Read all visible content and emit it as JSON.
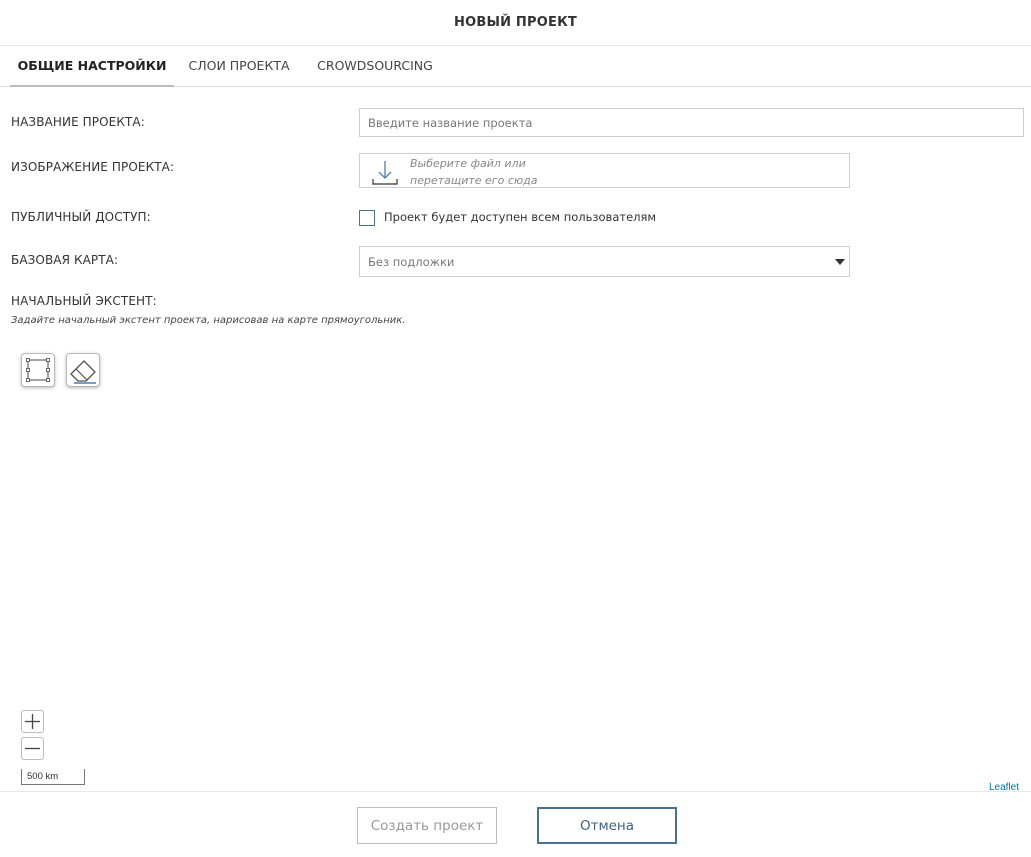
{
  "header": {
    "title": "НОВЫЙ ПРОЕКТ"
  },
  "tabs": [
    {
      "label": "ОБЩИЕ НАСТРОЙКИ",
      "active": true
    },
    {
      "label": "СЛОИ ПРОЕКТА",
      "active": false
    },
    {
      "label": "CROWDSOURCING",
      "active": false
    }
  ],
  "form": {
    "name": {
      "label": "НАЗВАНИЕ ПРОЕКТА:",
      "placeholder": "Введите название проекта",
      "value": ""
    },
    "image": {
      "label": "ИЗОБРАЖЕНИЕ ПРОЕКТА:",
      "hint_line1": "Выберите файл или",
      "hint_line2": "перетащите его сюда"
    },
    "public": {
      "label": "ПУБЛИЧНЫЙ ДОСТУП:",
      "checkbox_label": "Проект будет доступен всем пользователям",
      "checked": false
    },
    "basemap": {
      "label": "БАЗОВАЯ КАРТА:",
      "selected": "Без подложки"
    },
    "extent": {
      "label": "НАЧАЛЬНЫЙ ЭКСТЕНТ:",
      "hint": "Задайте начальный экстент проекта, нарисовав на карте прямоугольник."
    }
  },
  "map": {
    "scale": "500 km",
    "attribution": "Leaflet"
  },
  "footer": {
    "create_label": "Создать проект",
    "cancel_label": "Отмена"
  },
  "colors": {
    "accent": "#4a7193",
    "checkbox_border": "#4a6f8f",
    "link": "#0078a8"
  }
}
